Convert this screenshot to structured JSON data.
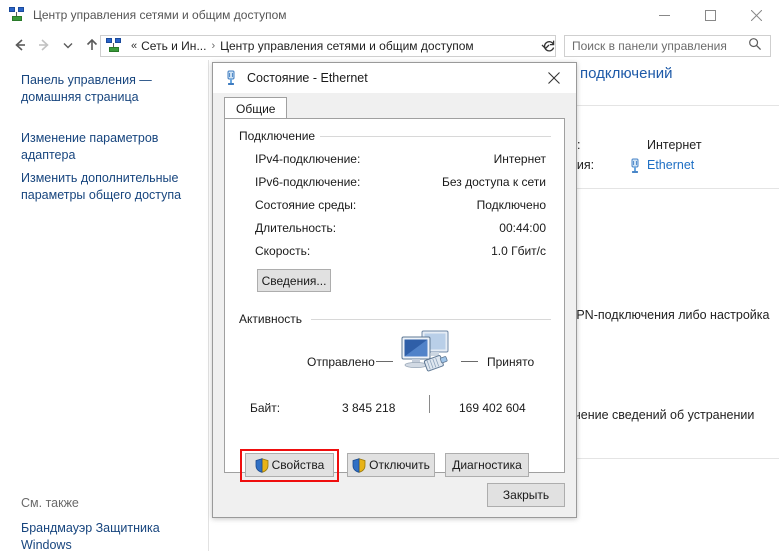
{
  "window": {
    "title": "Центр управления сетями и общим доступом",
    "icon": "network-center-icon",
    "minimize_label": "Свернуть",
    "maximize_label": "Развернуть",
    "close_label": "Закрыть"
  },
  "navigation": {
    "back_icon": "arrow-left-icon",
    "forward_icon": "arrow-right-icon",
    "recent_icon": "chevron-down-icon",
    "up_icon": "arrow-up-icon"
  },
  "address_bar": {
    "icon": "network-center-icon",
    "prefix": "«",
    "crumb1": "Сеть и Ин...",
    "separator": "›",
    "crumb2": "Центр управления сетями и общим доступом",
    "dropdown_icon": "chevron-down-icon",
    "refresh_icon": "refresh-icon"
  },
  "search": {
    "placeholder": "Поиск в панели управления",
    "value": "",
    "icon": "search-icon"
  },
  "sidebar": {
    "links": [
      "Панель управления — домашняя страница",
      "Изменение параметров адаптера",
      "Изменить дополнительные параметры общего доступа"
    ],
    "see_also_label": "См. также",
    "see_also_links": [
      "Брандмауэр Защитника Windows"
    ]
  },
  "background": {
    "heading": "подключений",
    "row1_label": "а:",
    "row1_value": "Интернет",
    "row2_label": "ния:",
    "row2_value": "Ethernet",
    "row2_icon": "ethernet-icon",
    "text1": "VPN-подключения либо настройка",
    "text2": "учение сведений об устранении"
  },
  "dialog": {
    "title": "Состояние - Ethernet",
    "icon": "ethernet-icon",
    "close_icon": "close-icon",
    "tab": "Общие",
    "connection": {
      "group_title": "Подключение",
      "rows": [
        {
          "label": "IPv4-подключение:",
          "value": "Интернет"
        },
        {
          "label": "IPv6-подключение:",
          "value": "Без доступа к сети"
        },
        {
          "label": "Состояние среды:",
          "value": "Подключено"
        },
        {
          "label": "Длительность:",
          "value": "00:44:00"
        },
        {
          "label": "Скорость:",
          "value": "1.0 Гбит/с"
        }
      ],
      "details_button": "Сведения..."
    },
    "activity": {
      "group_title": "Активность",
      "sent_label": "Отправлено",
      "received_label": "Принято",
      "bytes_label": "Байт:",
      "sent_value": "3 845 218",
      "received_value": "169 402 604",
      "icon": "two-computers-network-icon"
    },
    "buttons": {
      "properties": "Свойства",
      "disable": "Отключить",
      "diagnose": "Диагностика",
      "close": "Закрыть",
      "shield_icon": "uac-shield-icon"
    },
    "highlight_color": "#ef0e0e"
  }
}
